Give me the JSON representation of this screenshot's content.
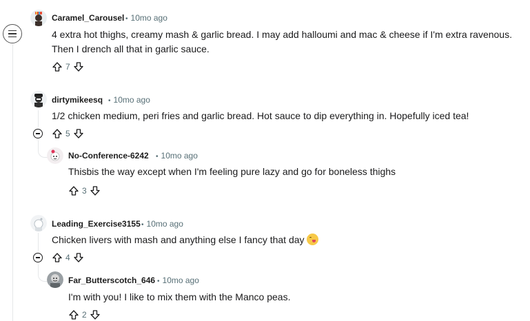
{
  "comments": [
    {
      "author": "Caramel_Carousel",
      "time": "10mo ago",
      "body_lines": [
        "4 extra hot thighs, creamy mash & garlic bread. I may add halloumi and mac & cheese if I'm extra ravenous.",
        "Then I drench all that in garlic sauce."
      ],
      "votes": "7"
    },
    {
      "author": "dirtymikeesq",
      "time": "10mo ago",
      "body": "1/2 chicken medium, peri fries and garlic bread. Hot sauce to dip everything in. Hopefully iced tea!",
      "votes": "5",
      "reply": {
        "author": "No-Conference-6242",
        "time": "10mo ago",
        "body": "Thisbis the way except when I'm feeling pure lazy and go for boneless thighs",
        "votes": "3"
      }
    },
    {
      "author": "Leading_Exercise3155",
      "time": "10mo ago",
      "body": "Chicken livers with mash and anything else I fancy that day",
      "emoji": "yum-face-emoji",
      "votes": "4",
      "reply": {
        "author": "Far_Butterscotch_646",
        "time": "10mo ago",
        "body": "I'm with you! I like to mix them with the Manco peas.",
        "votes": "2"
      }
    }
  ],
  "meta_separator": "•",
  "colors": {
    "meta": "#576f76",
    "thread_line": "#e5e7e9",
    "text": "#1a1a1b"
  }
}
